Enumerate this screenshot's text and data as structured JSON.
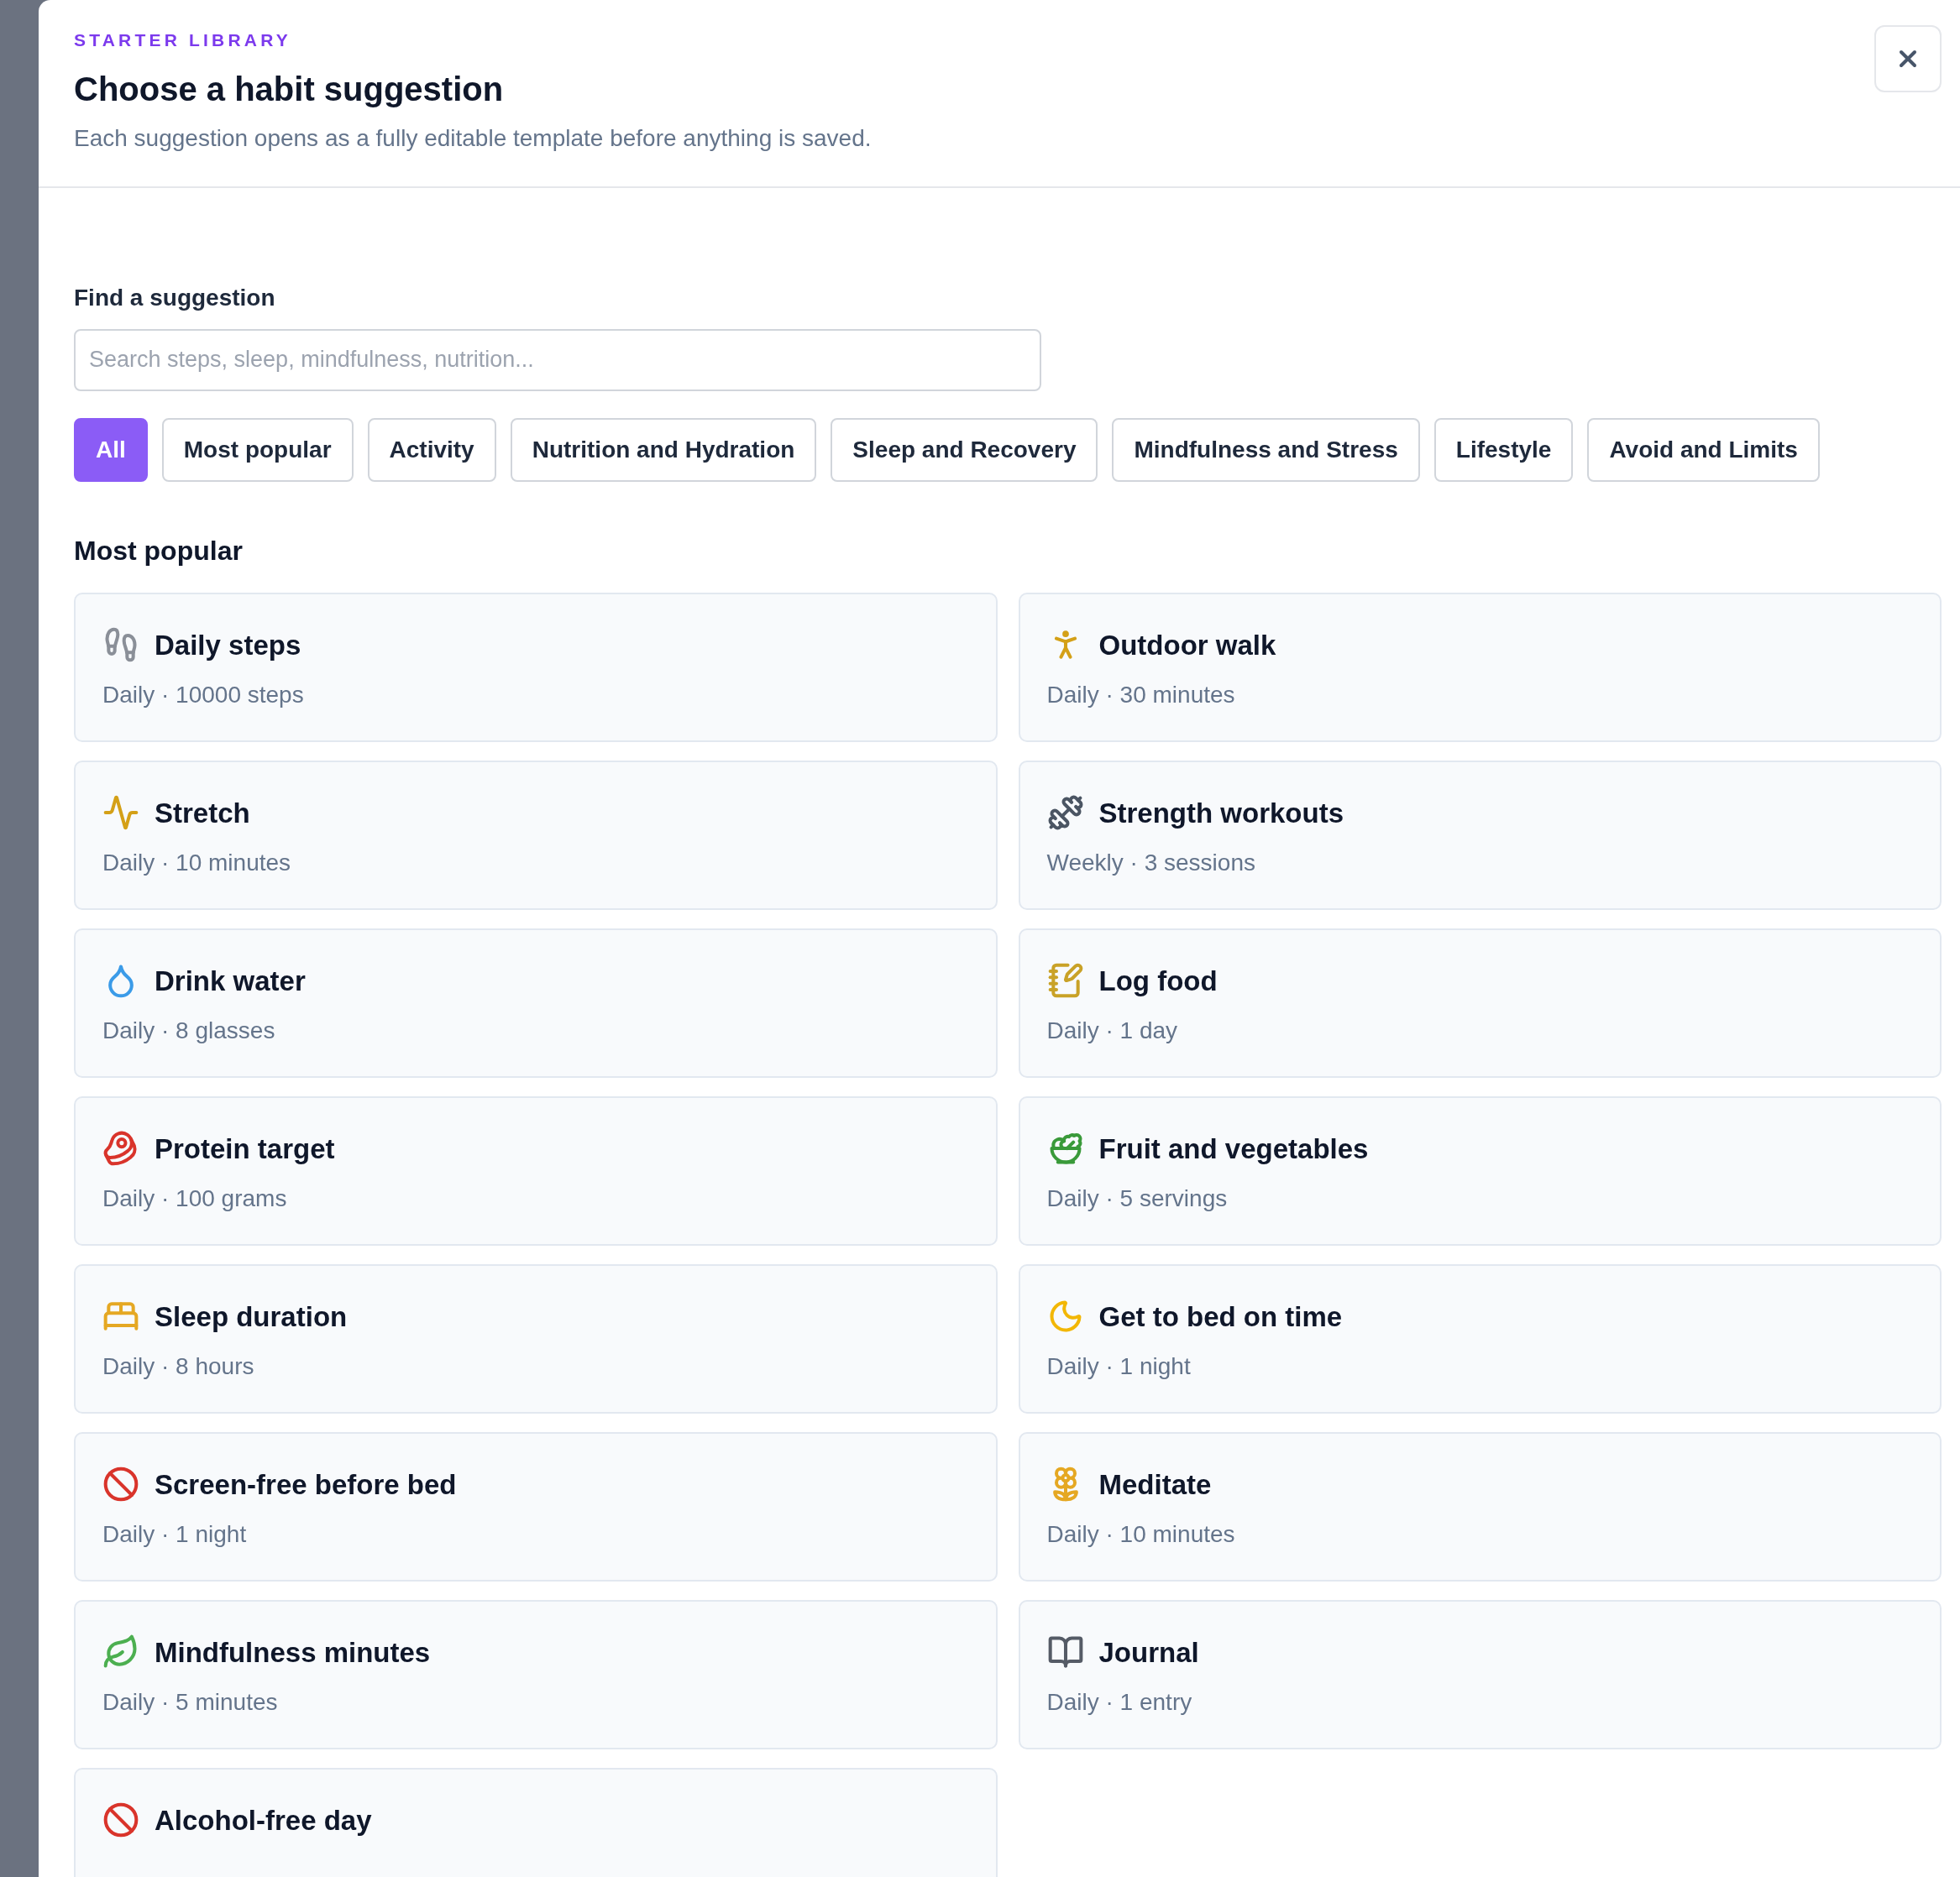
{
  "header": {
    "overline": "STARTER LIBRARY",
    "title": "Choose a habit suggestion",
    "subtitle": "Each suggestion opens as a fully editable template before anything is saved."
  },
  "search": {
    "label": "Find a suggestion",
    "placeholder": "Search steps, sleep, mindfulness, nutrition..."
  },
  "filters": [
    {
      "label": "All",
      "selected": true
    },
    {
      "label": "Most popular",
      "selected": false
    },
    {
      "label": "Activity",
      "selected": false
    },
    {
      "label": "Nutrition and Hydration",
      "selected": false
    },
    {
      "label": "Sleep and Recovery",
      "selected": false
    },
    {
      "label": "Mindfulness and Stress",
      "selected": false
    },
    {
      "label": "Lifestyle",
      "selected": false
    },
    {
      "label": "Avoid and Limits",
      "selected": false
    }
  ],
  "section": {
    "title": "Most popular"
  },
  "suggestions": [
    {
      "title": "Daily steps",
      "detail": "Daily · 10000 steps"
    },
    {
      "title": "Outdoor walk",
      "detail": "Daily · 30 minutes"
    },
    {
      "title": "Stretch",
      "detail": "Daily · 10 minutes"
    },
    {
      "title": "Strength workouts",
      "detail": "Weekly · 3 sessions"
    },
    {
      "title": "Drink water",
      "detail": "Daily · 8 glasses"
    },
    {
      "title": "Log food",
      "detail": "Daily · 1 day"
    },
    {
      "title": "Protein target",
      "detail": "Daily · 100 grams"
    },
    {
      "title": "Fruit and vegetables",
      "detail": "Daily · 5 servings"
    },
    {
      "title": "Sleep duration",
      "detail": "Daily · 8 hours"
    },
    {
      "title": "Get to bed on time",
      "detail": "Daily · 1 night"
    },
    {
      "title": "Screen-free before bed",
      "detail": "Daily · 1 night"
    },
    {
      "title": "Meditate",
      "detail": "Daily · 10 minutes"
    },
    {
      "title": "Mindfulness minutes",
      "detail": "Daily · 5 minutes"
    },
    {
      "title": "Journal",
      "detail": "Daily · 1 entry"
    },
    {
      "title": "Alcohol-free day"
    }
  ]
}
